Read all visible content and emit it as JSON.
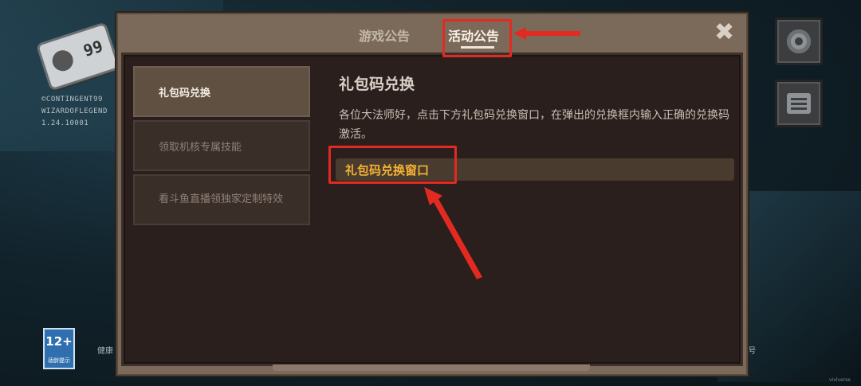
{
  "left_info": {
    "gamepad_badge": "99",
    "version_lines": [
      "©CONTINGENT99",
      "WIZARDOFLEGEND",
      "1.24.10001"
    ],
    "age_rating": "12+",
    "age_rating_sub": "CADPA",
    "age_rating_note": "适龄提示",
    "health_left": "健康",
    "health_right": "4号",
    "watermark": "vivlverse"
  },
  "side_buttons": {
    "settings_icon": "gear-icon",
    "notice_icon": "list-icon"
  },
  "modal": {
    "tabs": [
      {
        "label": "游戏公告",
        "active": false
      },
      {
        "label": "活动公告",
        "active": true
      }
    ],
    "close_icon": "✖",
    "side_tabs": [
      {
        "label": "礼包码兑换",
        "active": true
      },
      {
        "label": "领取机核专属技能",
        "active": false
      },
      {
        "label": "看斗鱼直播领独家定制特效",
        "active": false
      }
    ],
    "article": {
      "title": "礼包码兑换",
      "body": "各位大法师好，点击下方礼包码兑换窗口，在弹出的兑换框内输入正确的兑换码激活。",
      "redeem_label": "礼包码兑换窗口"
    }
  },
  "colors": {
    "highlight": "#e32a21",
    "redeem_text": "#f3b233",
    "panel": "#2a1f1c"
  }
}
